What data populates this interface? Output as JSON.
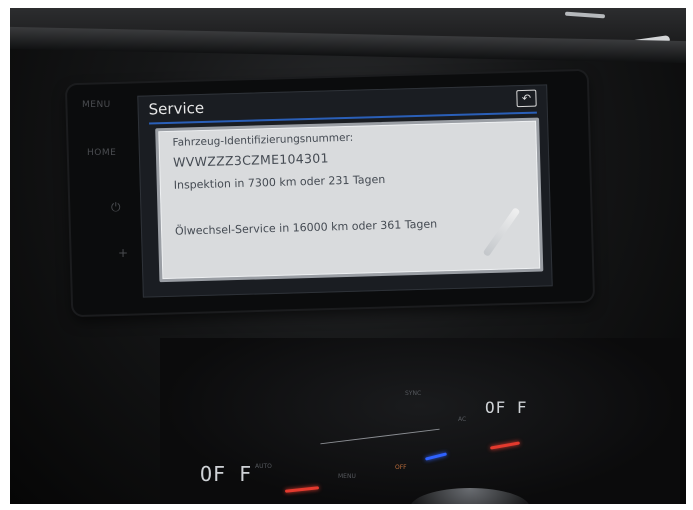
{
  "side_keys": [
    "MENU",
    "HOME",
    "⏻",
    "+"
  ],
  "screen": {
    "title": "Service",
    "back_icon": "back-arrow-icon",
    "vin_label": "Fahrzeug-Identifizierungsnummer:",
    "vin": "WVWZZZ3CZME104301",
    "inspection": "Inspektion in 7300 km oder 231 Tagen",
    "oil_service": "Ölwechsel-Service in 16000 km oder 361 Tagen",
    "accent_color": "#2a5fb8"
  },
  "climate": {
    "temp_left": "OF F",
    "temp_right": "OF F",
    "auto_label": "AUTO",
    "menu_label": "MENU",
    "sync_label": "SYNC",
    "ac_label": "AC",
    "off_label": "OFF"
  }
}
